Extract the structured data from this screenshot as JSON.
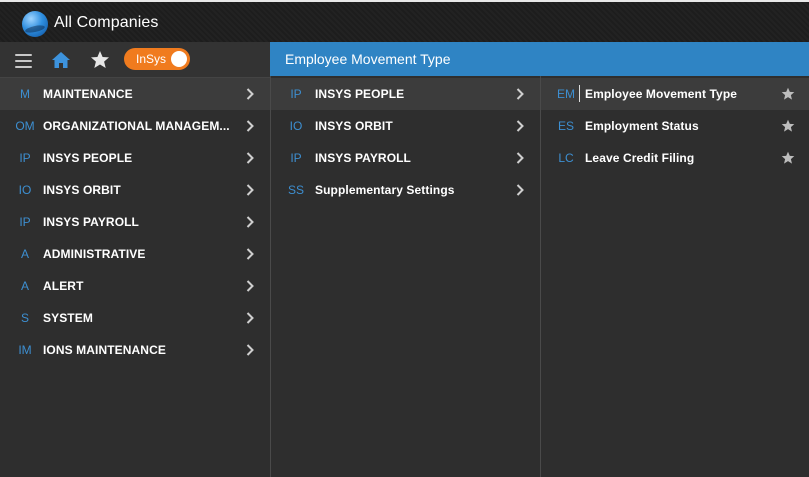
{
  "app": {
    "title": "All Companies"
  },
  "toolbar": {
    "toggle_label": "InSys"
  },
  "header": {
    "title": "Employee Movement Type"
  },
  "menu": [
    {
      "code": "M",
      "label": "MAINTENANCE",
      "active": true
    },
    {
      "code": "OM",
      "label": "ORGANIZATIONAL MANAGEM..."
    },
    {
      "code": "IP",
      "label": "INSYS PEOPLE"
    },
    {
      "code": "IO",
      "label": "INSYS ORBIT"
    },
    {
      "code": "IP",
      "label": "INSYS PAYROLL"
    },
    {
      "code": "A",
      "label": "ADMINISTRATIVE"
    },
    {
      "code": "A",
      "label": "ALERT"
    },
    {
      "code": "S",
      "label": "SYSTEM"
    },
    {
      "code": "IM",
      "label": "IONS MAINTENANCE"
    }
  ],
  "submenu": [
    {
      "code": "IP",
      "label": "INSYS PEOPLE",
      "active": true
    },
    {
      "code": "IO",
      "label": "INSYS ORBIT"
    },
    {
      "code": "IP",
      "label": "INSYS PAYROLL"
    },
    {
      "code": "SS",
      "label": "Supplementary Settings"
    }
  ],
  "items": [
    {
      "code": "EM",
      "label": "Employee Movement Type",
      "active": true
    },
    {
      "code": "ES",
      "label": "Employment Status"
    },
    {
      "code": "LC",
      "label": "Leave Credit Filing"
    }
  ],
  "colors": {
    "accent": "#2f84c4",
    "code": "#3d8fd1",
    "toggle": "#f07b1e"
  }
}
